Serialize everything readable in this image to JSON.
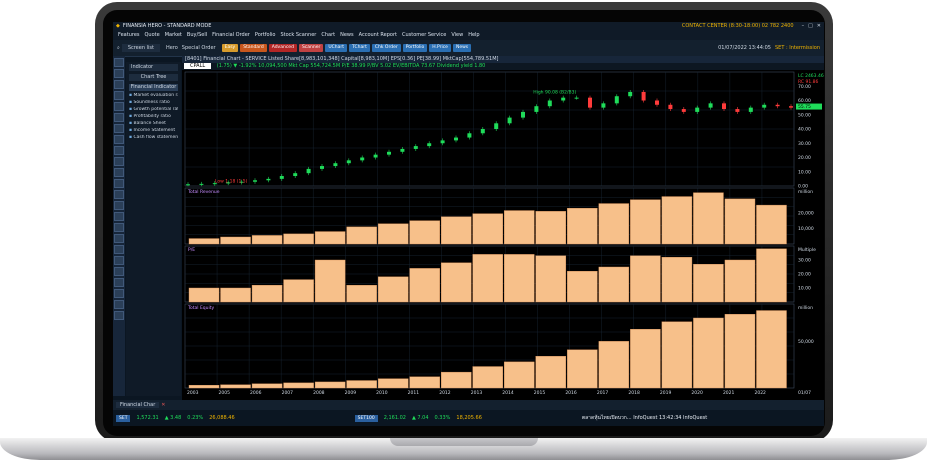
{
  "window": {
    "title": "FINANSIA HERO - STANDARD MODE",
    "contact": "CONTACT CENTER (8:30-18:00) 02 782 2400",
    "datetime": "01/07/2022 13:44:05",
    "set_label": "SET : Intermission",
    "accent": "#f0b400"
  },
  "menu": [
    "Features",
    "Quote",
    "Market",
    "Buy/Sell",
    "Financial Order",
    "Portfolio",
    "Stock Scanner",
    "Chart",
    "News",
    "Account Report",
    "Customer Service",
    "View",
    "Help"
  ],
  "toolbar": {
    "screen_list": "Screen list",
    "hero": "Hero",
    "special_order": "Special Order",
    "buttons": [
      {
        "label": "Easy",
        "color": "#d69b2c"
      },
      {
        "label": "Standard",
        "color": "#c8571d"
      },
      {
        "label": "Advanced",
        "color": "#b32626"
      },
      {
        "label": "Scanner",
        "color": "#c04242"
      },
      {
        "label": "UChart",
        "color": "#2a6fb3"
      },
      {
        "label": "TChart",
        "color": "#2a6fb3"
      },
      {
        "label": "Chk Order",
        "color": "#2a6fb3"
      },
      {
        "label": "Portfolio",
        "color": "#2a6fb3"
      },
      {
        "label": "H.Price",
        "color": "#2a6fb3"
      },
      {
        "label": "News",
        "color": "#2a6fb3"
      }
    ]
  },
  "chart_window": {
    "title": "[8401] Financial Chart - SERVICE Listed Share[8,983,101,348] Capital[8,983,10M] EPS[0.36] PE[38.99] MktCap[554,789.51M]",
    "symbol": "CPALL",
    "indicator": "Indicator",
    "info": "(1.75) ▼ -1.92%  10,094,500  Mkt Cap 554,724.5M  P/E 38.99  P/BV 5.02  EV/EBITDA 73.67  Dividend yield 1.80"
  },
  "panel": {
    "tab": "Chart Tree",
    "header": "Financial Indicator",
    "items": [
      "Market evaluation ratio",
      "Soundness ratio",
      "Growth potential ratio",
      "Profitability ratio",
      "Balance Sheet",
      "Income Statement",
      "Cash flow statement"
    ]
  },
  "status": {
    "tab": "Financial Char",
    "set_name": "SET",
    "set_val": "1,572.31",
    "set_chg": "▲ 3.48",
    "set_pct": "0.23%",
    "set_vol": "26,088.46",
    "set100_name": "SET100",
    "set100_val": "2,161.02",
    "set100_chg": "▲ 7.04",
    "set100_pct": "0.33%",
    "set100_vol": "18,205.66",
    "news": "ตลาดหุ้นไทยเปิดบวก... InfoQuest  13:42:34   InfoQuest"
  },
  "chart_data": [
    {
      "type": "candlestick",
      "ylim": [
        0,
        80
      ],
      "y_ticks": [
        0,
        10,
        20,
        30,
        40,
        50,
        60,
        70
      ],
      "annotations": [
        "High 90.08 (B2/B3)",
        "Low 1.18 (1.5)"
      ],
      "high_label": "LC 2463.46",
      "price_axis_label": "RC 91.86",
      "last_price": "55.75",
      "path": [
        1.2,
        1.5,
        2,
        2.5,
        3,
        4,
        5,
        7,
        9,
        12,
        14,
        16,
        18,
        20,
        22,
        24,
        26,
        28,
        30,
        32,
        34,
        37,
        40,
        44,
        48,
        52,
        56,
        60,
        62,
        62,
        55,
        58,
        63,
        66,
        60,
        57,
        54,
        52,
        55,
        58,
        54,
        52,
        55,
        57,
        56,
        55
      ]
    },
    {
      "type": "bar",
      "title": "Total Revenue",
      "unit": "million",
      "y_ticks": [
        "10,000",
        "20,000"
      ],
      "categories": [
        "2003",
        "2004",
        "2005",
        "2006",
        "2007",
        "2008",
        "2009",
        "2010",
        "2011",
        "2012",
        "2013",
        "2014",
        "2015",
        "2016",
        "2017",
        "2018",
        "2019",
        "2020",
        "2021"
      ],
      "values": [
        3500,
        4500,
        5500,
        6500,
        8000,
        11000,
        13000,
        15000,
        17500,
        19500,
        21500,
        21000,
        23000,
        26000,
        28500,
        30500,
        33000,
        29000,
        25000
      ],
      "ylim": [
        0,
        36000
      ]
    },
    {
      "type": "bar",
      "title": "P/E",
      "unit": "Multiple",
      "y_ticks": [
        "10.00",
        "20.00",
        "30.00"
      ],
      "categories": [
        "2003",
        "2004",
        "2005",
        "2006",
        "2007",
        "2008",
        "2009",
        "2010",
        "2011",
        "2012",
        "2013",
        "2014",
        "2015",
        "2016",
        "2017",
        "2018",
        "2019",
        "2020",
        "2021"
      ],
      "values": [
        10,
        10,
        12,
        16,
        30,
        12,
        18,
        24,
        28,
        34,
        34,
        33,
        22,
        25,
        33,
        32,
        27,
        30,
        38
      ],
      "ylim": [
        0,
        40
      ]
    },
    {
      "type": "bar",
      "title": "Total Equity",
      "unit": "million",
      "y_ticks": [
        "50,000"
      ],
      "categories": [
        "2003",
        "2004",
        "2005",
        "2006",
        "2007",
        "2008",
        "2009",
        "2010",
        "2011",
        "2012",
        "2013",
        "2014",
        "2015",
        "2016",
        "2017",
        "2018",
        "2019",
        "2020",
        "2021"
      ],
      "values": [
        3000,
        3500,
        4500,
        5500,
        6500,
        8000,
        10000,
        12000,
        17000,
        23000,
        28000,
        34000,
        41000,
        50000,
        63000,
        71000,
        75000,
        79000,
        83000
      ],
      "ylim": [
        0,
        90000
      ]
    }
  ],
  "x_axis": [
    "2003",
    "2005",
    "2006",
    "2007",
    "2008",
    "2009",
    "2010",
    "2011",
    "2012",
    "2013",
    "2014",
    "2015",
    "2016",
    "2017",
    "2018",
    "2019",
    "2020",
    "2021",
    "2022"
  ],
  "x_end": "01/07"
}
